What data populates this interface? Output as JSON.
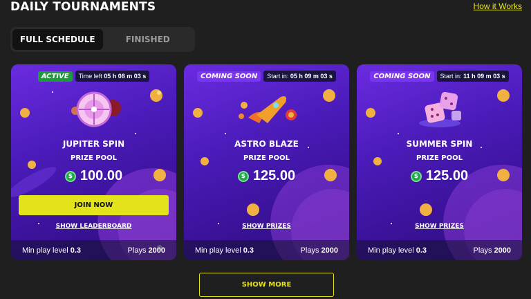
{
  "header": {
    "title": "DAILY TOURNAMENTS",
    "how_link": "How it Works"
  },
  "tabs": [
    {
      "label": "FULL SCHEDULE",
      "active": true
    },
    {
      "label": "FINISHED",
      "active": false
    }
  ],
  "cards": [
    {
      "status": "ACTIVE",
      "timer_prefix": "Time left",
      "timer_value": "05 h 08 m 03 s",
      "name": "JUPITER SPIN",
      "pool_label": "PRIZE POOL",
      "currency_icon": "dollar-coin-icon",
      "pool_amount": "100.00",
      "button": "JOIN NOW",
      "link": "SHOW LEADERBOARD",
      "min_label": "Min play level",
      "min_value": "0.3",
      "plays_label": "Plays",
      "plays_value": "2000"
    },
    {
      "status": "COMING SOON",
      "timer_prefix": "Start in:",
      "timer_value": "05 h 09 m 03 s",
      "name": "ASTRO BLAZE",
      "pool_label": "PRIZE POOL",
      "currency_icon": "dollar-coin-icon",
      "pool_amount": "125.00",
      "link": "SHOW PRIZES",
      "min_label": "Min play level",
      "min_value": "0.3",
      "plays_label": "Plays",
      "plays_value": "2000"
    },
    {
      "status": "COMING SOON",
      "timer_prefix": "Start in:",
      "timer_value": "11 h 09 m 03 s",
      "name": "SUMMER SPIN",
      "pool_label": "PRIZE POOL",
      "currency_icon": "dollar-coin-icon",
      "pool_amount": "125.00",
      "link": "SHOW PRIZES",
      "min_label": "Min play level",
      "min_value": "0.3",
      "plays_label": "Plays",
      "plays_value": "2000"
    }
  ],
  "show_more": "SHOW MORE",
  "colors": {
    "accent": "#e3e31b",
    "active_badge": "#1c9a3c",
    "soon_badge": "#7b35f0",
    "card_purple": "#5a22cc"
  }
}
